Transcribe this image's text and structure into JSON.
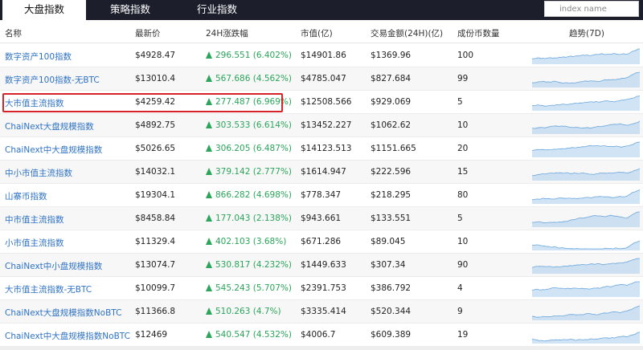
{
  "tabs": [
    {
      "label": "大盘指数"
    },
    {
      "label": "策略指数"
    },
    {
      "label": "行业指数"
    }
  ],
  "search": {
    "placeholder": "index name"
  },
  "headers": {
    "name": "名称",
    "price": "最新价",
    "change": "24H涨跌幅",
    "market_cap": "市值(亿)",
    "volume": "交易金额(24H)(亿)",
    "count": "成份币数量",
    "trend": "趋势(7D)"
  },
  "rows": [
    {
      "name": "数字资产100指数",
      "price": "$4928.47",
      "change": "296.551 (6.402%)",
      "market_cap": "$14901.86",
      "volume": "$1369.96",
      "count": "100"
    },
    {
      "name": "数字资产100指数-无BTC",
      "price": "$13010.4",
      "change": "567.686 (4.562%)",
      "market_cap": "$4785.047",
      "volume": "$827.684",
      "count": "99"
    },
    {
      "name": "大市值主流指数",
      "price": "$4259.42",
      "change": "277.487 (6.969%)",
      "market_cap": "$12508.566",
      "volume": "$929.069",
      "count": "5"
    },
    {
      "name": "ChaiNext大盘规模指数",
      "price": "$4892.75",
      "change": "303.533 (6.614%)",
      "market_cap": "$13452.227",
      "volume": "$1062.62",
      "count": "10"
    },
    {
      "name": "ChaiNext中大盘规模指数",
      "price": "$5026.65",
      "change": "306.205 (6.487%)",
      "market_cap": "$14123.513",
      "volume": "$1151.665",
      "count": "20"
    },
    {
      "name": "中小市值主流指数",
      "price": "$14032.1",
      "change": "379.142 (2.777%)",
      "market_cap": "$1614.947",
      "volume": "$222.596",
      "count": "15"
    },
    {
      "name": "山寨币指数",
      "price": "$19304.1",
      "change": "866.282 (4.698%)",
      "market_cap": "$778.347",
      "volume": "$218.295",
      "count": "80"
    },
    {
      "name": "中市值主流指数",
      "price": "$8458.84",
      "change": "177.043 (2.138%)",
      "market_cap": "$943.661",
      "volume": "$133.551",
      "count": "5"
    },
    {
      "name": "小市值主流指数",
      "price": "$11329.4",
      "change": "402.103 (3.68%)",
      "market_cap": "$671.286",
      "volume": "$89.045",
      "count": "10"
    },
    {
      "name": "ChaiNext中小盘规模指数",
      "price": "$13074.7",
      "change": "530.817 (4.232%)",
      "market_cap": "$1449.633",
      "volume": "$307.34",
      "count": "90"
    },
    {
      "name": "大市值主流指数-无BTC",
      "price": "$10099.7",
      "change": "545.243 (5.707%)",
      "market_cap": "$2391.753",
      "volume": "$386.792",
      "count": "4"
    },
    {
      "name": "ChaiNext大盘规模指数NoBTC",
      "price": "$11366.8",
      "change": "510.263 (4.7%)",
      "market_cap": "$3335.414",
      "volume": "$520.344",
      "count": "9"
    },
    {
      "name": "ChaiNext中大盘规模指数NoBTC",
      "price": "$12469",
      "change": "540.547 (4.532%)",
      "market_cap": "$4006.7",
      "volume": "$609.389",
      "count": "19"
    }
  ],
  "colors": {
    "accent_link": "#2e72c5",
    "up_green": "#2aa55a",
    "highlight_red": "#d6232a",
    "topbar": "#1c1f2b",
    "sparkline": "#a9cdee"
  },
  "icons": {
    "change_up": "triangle-up-icon"
  }
}
